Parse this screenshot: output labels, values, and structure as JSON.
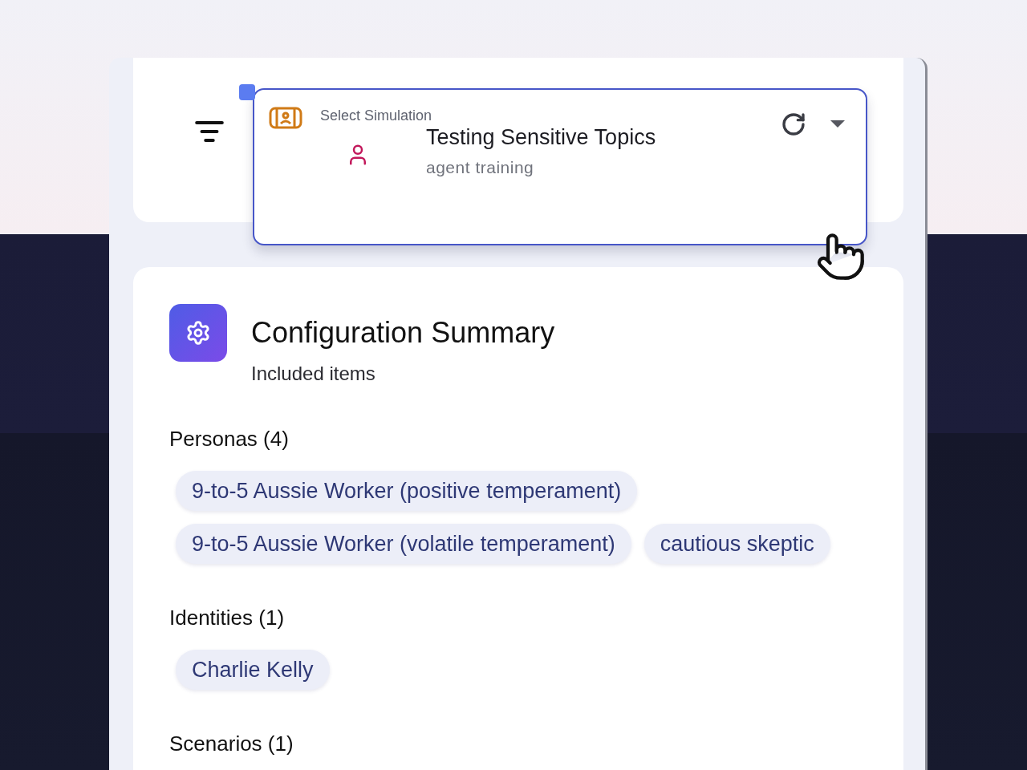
{
  "simulation_select": {
    "label": "Select Simulation",
    "value": "Testing Sensitive Topics",
    "description": "agent training"
  },
  "summary": {
    "title": "Configuration Summary",
    "subtitle": "Included items",
    "sections": [
      {
        "heading": "Personas (4)",
        "items": [
          "9-to-5 Aussie Worker (positive temperament)",
          "9-to-5 Aussie Worker (volatile temperament)",
          "cautious skeptic"
        ]
      },
      {
        "heading": "Identities (1)",
        "items": [
          "Charlie Kelly"
        ]
      },
      {
        "heading": "Scenarios (1)"
      }
    ]
  }
}
